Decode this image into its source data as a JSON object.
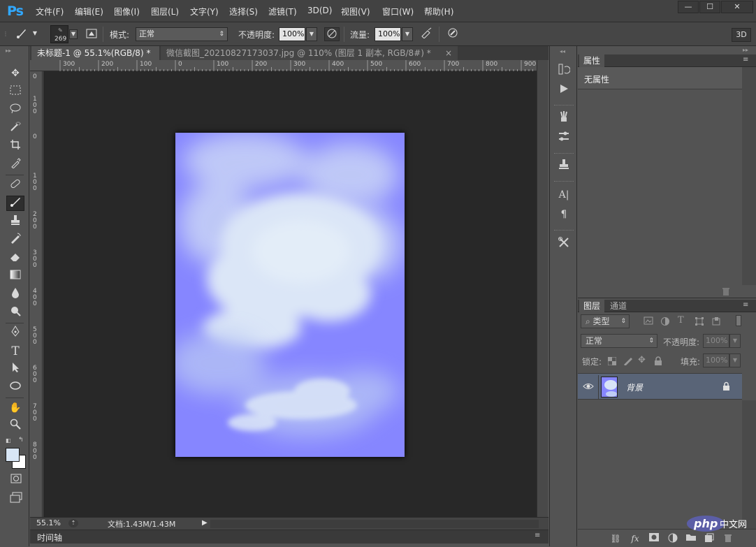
{
  "app": {
    "logo": "Ps",
    "window_buttons": [
      "—",
      "☐",
      "✕"
    ]
  },
  "menu": [
    "文件(F)",
    "编辑(E)",
    "图像(I)",
    "图层(L)",
    "文字(Y)",
    "选择(S)",
    "滤镜(T)",
    "3D(D)",
    "视图(V)",
    "窗口(W)",
    "帮助(H)"
  ],
  "options": {
    "brush_size": "269",
    "mode_label": "模式:",
    "mode_value": "正常",
    "opacity_label": "不透明度:",
    "opacity_value": "100%",
    "flow_label": "流量:",
    "flow_value": "100%",
    "workspace_button": "3D"
  },
  "tabs": [
    {
      "label": "未标题-1 @ 55.1%(RGB/8) *",
      "close": "×"
    },
    {
      "label": "微信截图_20210827173037.jpg @ 110% (图层 1 副本, RGB/8#) *",
      "close": "×"
    }
  ],
  "ruler_h": [
    "300",
    "200",
    "100",
    "0",
    "100",
    "200",
    "300",
    "400",
    "500",
    "600",
    "700",
    "800",
    "900"
  ],
  "ruler_v": [
    "0",
    "100",
    "0",
    "100",
    "200",
    "300",
    "400",
    "500",
    "600",
    "700",
    "800"
  ],
  "status": {
    "zoom": "55.1%",
    "doc": "文档:1.43M/1.43M"
  },
  "timeline": {
    "label": "时间轴"
  },
  "properties": {
    "tab": "属性",
    "empty_text": "无属性"
  },
  "layers": {
    "tabs": [
      "图层",
      "通道"
    ],
    "filter_kind": "类型",
    "blend_mode": "正常",
    "opacity_label": "不透明度:",
    "opacity_value": "100%",
    "lock_label": "锁定:",
    "fill_label": "填充:",
    "fill_value": "100%",
    "layer_name": "背景"
  },
  "watermark": {
    "text": "php",
    "suffix": "中文网"
  },
  "colors": {
    "canvas": "#8686ff",
    "cloud": "#d6e4f6",
    "foreground": "#d8e6f6",
    "background": "#ffffff",
    "selected_layer": "#596477"
  }
}
